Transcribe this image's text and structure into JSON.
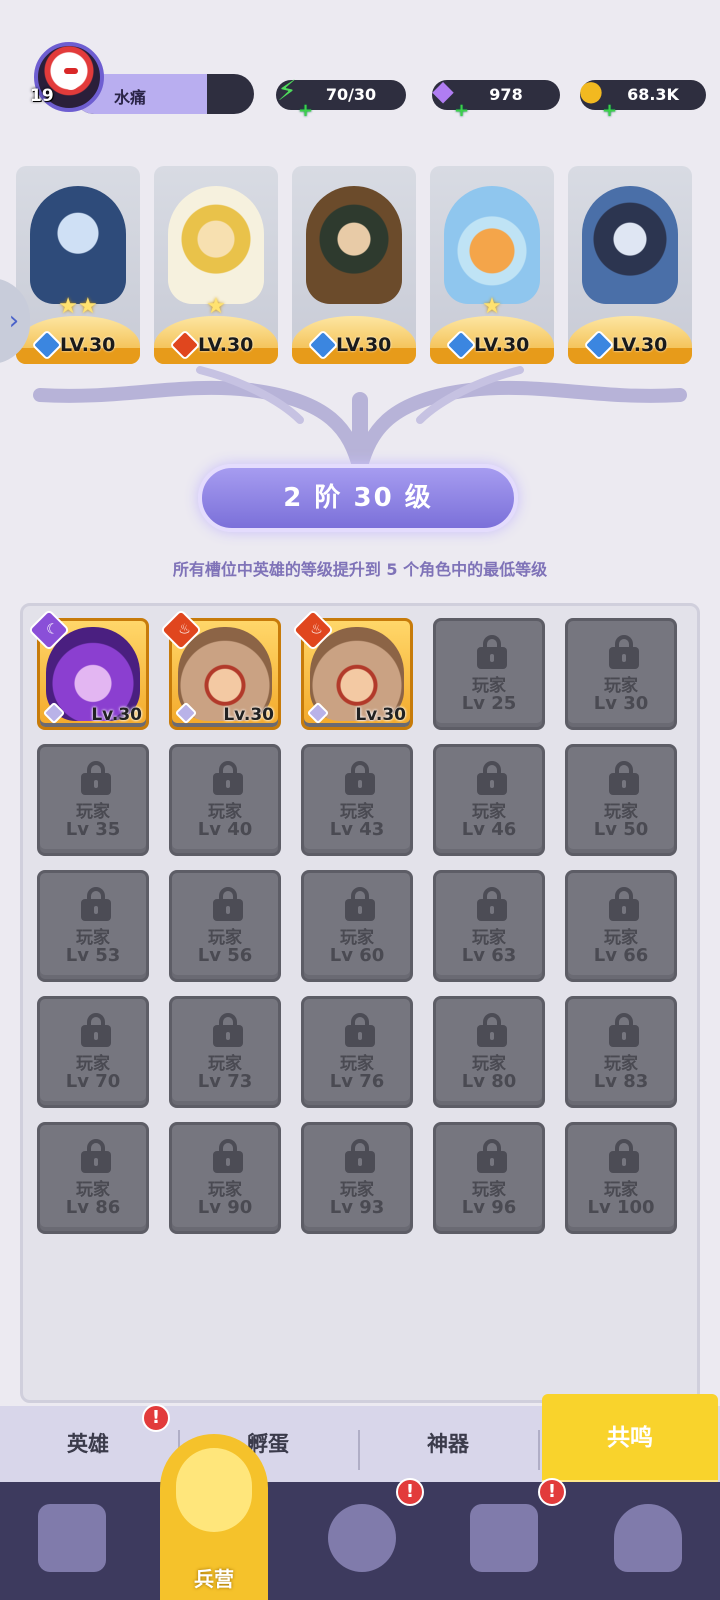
{
  "player": {
    "level": "19",
    "name": "水痛",
    "exp_fraction": 0.74
  },
  "resources": [
    {
      "name": "energy",
      "icon": "lightning-icon",
      "value": "70/30"
    },
    {
      "name": "gems",
      "icon": "gem-icon",
      "value": "978"
    },
    {
      "name": "gold",
      "icon": "coin-icon",
      "value": "68.3K"
    }
  ],
  "top_heroes": [
    {
      "level": "LV.30",
      "element": "water",
      "stars": "★★"
    },
    {
      "level": "LV.30",
      "element": "fire",
      "stars": "★"
    },
    {
      "level": "LV.30",
      "element": "water",
      "stars": ""
    },
    {
      "level": "LV.30",
      "element": "water",
      "stars": "★"
    },
    {
      "level": "LV.30",
      "element": "water",
      "stars": ""
    }
  ],
  "rank": {
    "label": "2 阶 30 级"
  },
  "description": "所有槽位中英雄的等级提升到 5 个角色中的最低等级",
  "filled_slots": [
    {
      "level": "Lv.30",
      "element": "dark"
    },
    {
      "level": "Lv.30",
      "element": "fire"
    },
    {
      "level": "Lv.30",
      "element": "fire"
    }
  ],
  "locked_label": "玩家",
  "locked_slots": [
    "Lv 25",
    "Lv 30",
    "Lv 35",
    "Lv 40",
    "Lv 43",
    "Lv 46",
    "Lv 50",
    "Lv 53",
    "Lv 56",
    "Lv 60",
    "Lv 63",
    "Lv 66",
    "Lv 70",
    "Lv 73",
    "Lv 76",
    "Lv 80",
    "Lv 83",
    "Lv 86",
    "Lv 90",
    "Lv 93",
    "Lv 96",
    "Lv 100"
  ],
  "subtabs": [
    {
      "label": "英雄",
      "alert": "!"
    },
    {
      "label": "孵蛋"
    },
    {
      "label": "神器"
    },
    {
      "label": "共鸣",
      "active": true
    }
  ],
  "nav": [
    {
      "label": "",
      "icon": "cards-icon"
    },
    {
      "label": "兵营",
      "icon": "barracks-icon",
      "active": true
    },
    {
      "label": "",
      "icon": "map-icon",
      "alert": "!"
    },
    {
      "label": "",
      "icon": "temple-icon",
      "alert": "!"
    },
    {
      "label": "",
      "icon": "mushroom-icon"
    }
  ],
  "colors": {
    "accent": "#f9d32c",
    "panel": "#e3e2ea",
    "rank": "#8f84e6",
    "water": "#3b86e0",
    "fire": "#e0461e",
    "dark": "#8a4fd8"
  }
}
